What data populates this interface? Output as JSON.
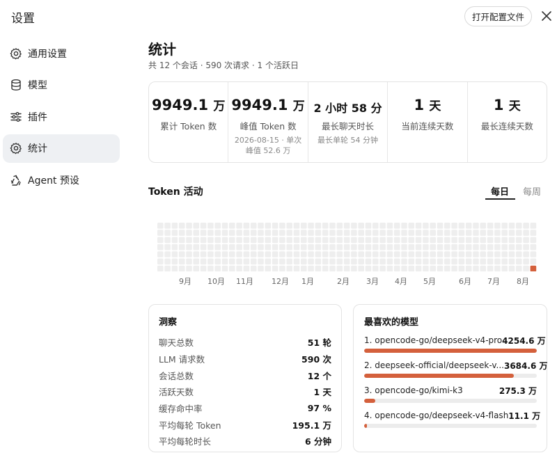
{
  "app": {
    "title": "设置",
    "open_config": "打开配置文件"
  },
  "sidebar": {
    "items": [
      {
        "label": "通用设置",
        "icon": "gear-icon"
      },
      {
        "label": "模型",
        "icon": "database-icon"
      },
      {
        "label": "插件",
        "icon": "sliders-icon"
      },
      {
        "label": "统计",
        "icon": "gear-icon",
        "active": true
      },
      {
        "label": "Agent 预设",
        "icon": "recycle-icon"
      }
    ]
  },
  "page": {
    "title": "统计",
    "subtitle": "共 12 个会话 · 590 次请求 · 1 个活跃日"
  },
  "stats": [
    {
      "value": "9949.1",
      "unit": "万",
      "label": "累计 Token 数"
    },
    {
      "value": "9949.1",
      "unit": "万",
      "label": "峰值 Token 数",
      "note1": "2026-08-15 · 单次",
      "note2": "峰值 52.6 万"
    },
    {
      "value": "2 小时 58 分",
      "label": "最长聊天时长",
      "note1": "最长单轮 54 分钟"
    },
    {
      "value": "1",
      "unit": "天",
      "label": "当前连续天数"
    },
    {
      "value": "1",
      "unit": "天",
      "label": "最长连续天数"
    }
  ],
  "activity": {
    "title": "Token 活动",
    "tab_daily": "每日",
    "tab_weekly": "每周",
    "months": [
      "9月",
      "10月",
      "11月",
      "12月",
      "1月",
      "2月",
      "3月",
      "4月",
      "5月",
      "6月",
      "7月",
      "8月"
    ],
    "active_color": "#d4603c",
    "empty_color": "#eeeeee"
  },
  "insights": {
    "title": "洞察",
    "rows": [
      {
        "label": "聊天总数",
        "value": "51 轮"
      },
      {
        "label": "LLM 请求数",
        "value": "590 次"
      },
      {
        "label": "会话总数",
        "value": "12 个"
      },
      {
        "label": "活跃天数",
        "value": "1 天"
      },
      {
        "label": "缓存命中率",
        "value": "97 %"
      },
      {
        "label": "平均每轮 Token",
        "value": "195.1 万"
      },
      {
        "label": "平均每轮时长",
        "value": "6 分钟"
      }
    ]
  },
  "favorites": {
    "title": "最喜欢的模型",
    "models": [
      {
        "name": "1. opencode-go/deepseek-v4-pro",
        "amount": "4254.6 万",
        "share": 1.0
      },
      {
        "name": "2. deepseek-official/deepseek-v...",
        "amount": "3684.6 万",
        "share": 0.866
      },
      {
        "name": "3. opencode-go/kimi-k3",
        "amount": "275.3 万",
        "share": 0.065
      },
      {
        "name": "4. opencode-go/deepseek-v4-flash",
        "amount": "11.1 万",
        "share": 0.003
      }
    ]
  }
}
